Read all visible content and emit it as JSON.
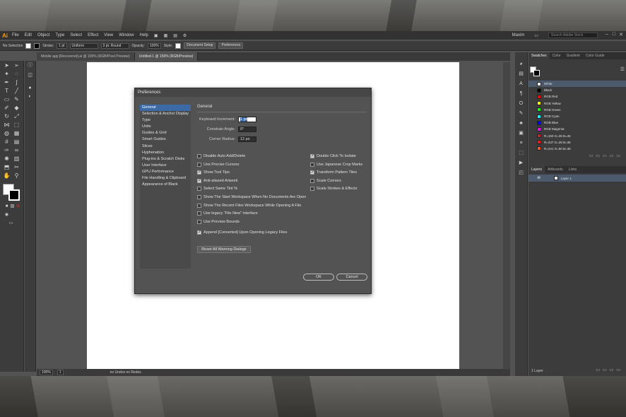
{
  "menubar": {
    "logo": "Ai",
    "items": [
      "File",
      "Edit",
      "Object",
      "Type",
      "Select",
      "Effect",
      "View",
      "Window",
      "Help"
    ],
    "user": "Maxim",
    "search_placeholder": "Search Adobe Stock"
  },
  "controlbar": {
    "selection": "No Selection",
    "stroke_label": "Stroke:",
    "stroke_value": "1 pt",
    "profile_label": "Uniform",
    "brush_label": "3 pt. Round",
    "opacity_label": "Opacity:",
    "opacity_value": "100%",
    "style_label": "Style:",
    "document_setup": "Document Setup",
    "preferences": "Preferences"
  },
  "tabs": [
    "Mobile app [Recovered].ai @ 100% (RGB/Pixel Preview)",
    "Untitled-1 @ 150% (RGB/Preview)"
  ],
  "status": {
    "zoom": "100%",
    "page": "1",
    "tool_hint": "no Undos no Redos"
  },
  "swatches_panel": {
    "tabs": [
      "Swatches",
      "Color",
      "Gradient",
      "Color Guide"
    ],
    "items": [
      {
        "name": "White",
        "color": "#ffffff"
      },
      {
        "name": "Black",
        "color": "#000000"
      },
      {
        "name": "RGB Red",
        "color": "#ff0000"
      },
      {
        "name": "RGB Yellow",
        "color": "#ffff00"
      },
      {
        "name": "RGB Green",
        "color": "#00ff00"
      },
      {
        "name": "RGB Cyan",
        "color": "#00ffff"
      },
      {
        "name": "RGB Blue",
        "color": "#0000ff"
      },
      {
        "name": "RGB Magenta",
        "color": "#ff00ff"
      },
      {
        "name": "R=193 G=39 B=45",
        "color": "#c1272d"
      },
      {
        "name": "R=237 G=28 B=36",
        "color": "#ed1c24"
      },
      {
        "name": "R=241 G=90 B=36",
        "color": "#f15a24"
      }
    ]
  },
  "layers_panel": {
    "tabs": [
      "Layers",
      "Artboards",
      "Links"
    ],
    "layer_name": "Layer 1",
    "count": "1 Layer"
  },
  "dialog": {
    "title": "Preferences",
    "categories": [
      "General",
      "Selection & Anchor Display",
      "Type",
      "Units",
      "Guides & Grid",
      "Smart Guides",
      "Slices",
      "Hyphenation",
      "Plug-ins & Scratch Disks",
      "User Interface",
      "GPU Performance",
      "File Handling & Clipboard",
      "Appearance of Black"
    ],
    "section": "General",
    "keyboard_increment_label": "Keyboard Increment:",
    "keyboard_increment_value": "1 px",
    "constrain_angle_label": "Constrain Angle:",
    "constrain_angle_value": "0°",
    "corner_radius_label": "Corner Radius:",
    "corner_radius_value": "12 px",
    "left_checks": [
      {
        "label": "Disable Auto Add/Delete",
        "checked": false
      },
      {
        "label": "Use Precise Cursors",
        "checked": false
      },
      {
        "label": "Show Tool Tips",
        "checked": true
      },
      {
        "label": "Anti-aliased Artwork",
        "checked": true
      },
      {
        "label": "Select Same Tint %",
        "checked": false
      },
      {
        "label": "Show The Start Workspace When No Documents Are Open",
        "checked": false
      },
      {
        "label": "Show The Recent Files Workspace While Opening A File",
        "checked": false
      },
      {
        "label": "Use legacy \"File New\" interface",
        "checked": false
      },
      {
        "label": "Use Preview Bounds",
        "checked": false
      }
    ],
    "append_check": {
      "label": "Append [Converted] Upon Opening Legacy Files",
      "checked": true
    },
    "right_checks": [
      {
        "label": "Double Click To Isolate",
        "checked": true
      },
      {
        "label": "Use Japanese Crop Marks",
        "checked": false
      },
      {
        "label": "Transform Pattern Tiles",
        "checked": true
      },
      {
        "label": "Scale Corners",
        "checked": false
      },
      {
        "label": "Scale Strokes & Effects",
        "checked": false
      }
    ],
    "reset_label": "Reset All Warning Dialogs",
    "ok_label": "OK",
    "cancel_label": "Cancel"
  }
}
